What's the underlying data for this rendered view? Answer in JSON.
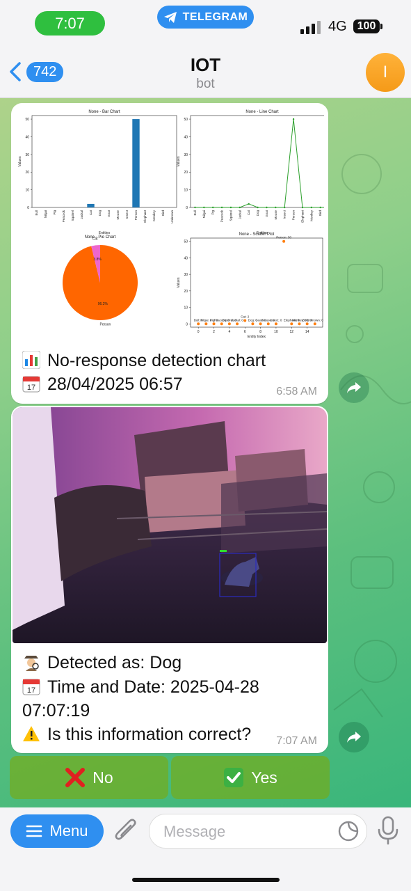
{
  "status_bar": {
    "time": "7:07",
    "app_pill": "TELEGRAM",
    "network": "4G",
    "battery": "100"
  },
  "header": {
    "back_count": "742",
    "title": "IOT",
    "subtitle": "bot",
    "avatar_letter": "I"
  },
  "chart_message": {
    "caption_line1": "No-response detection chart",
    "caption_line2": "28/04/2025 06:57",
    "time": "6:58 AM",
    "emoji1": "bar-chart-icon",
    "emoji2": "calendar-icon"
  },
  "chart_data": [
    {
      "type": "bar",
      "title": "None - Bar Chart",
      "xlabel": "Entities",
      "ylabel": "Values",
      "categories": [
        "Bull",
        "Nilgai",
        "Pig",
        "Peacock",
        "Squirrel",
        "Jackal",
        "Cat",
        "Dog",
        "Goat",
        "Mouse",
        "Insect",
        "Person",
        "Elephant",
        "Monkey",
        "Bird",
        "Unknown"
      ],
      "values": [
        0,
        0,
        0,
        0,
        0,
        0,
        2,
        0,
        0,
        0,
        0,
        50,
        0,
        0,
        0,
        0
      ],
      "yticks": [
        "0",
        "10",
        "20",
        "30",
        "40",
        "50"
      ],
      "ylim": [
        0,
        52
      ],
      "color": "#1f77b4"
    },
    {
      "type": "line",
      "title": "None - Line Chart",
      "xlabel": "Entities",
      "ylabel": "Values",
      "categories": [
        "Bull",
        "Nilgai",
        "Pig",
        "Peacock",
        "Squirrel",
        "Jackal",
        "Cat",
        "Dog",
        "Goat",
        "Mouse",
        "Insect",
        "Person",
        "Elephant",
        "Monkey",
        "Bird",
        "Unknown"
      ],
      "values": [
        0,
        0,
        0,
        0,
        0,
        0,
        2,
        0,
        0,
        0,
        0,
        50,
        0,
        0,
        0,
        0
      ],
      "yticks": [
        "0",
        "10",
        "20",
        "30",
        "40",
        "50"
      ],
      "ylim": [
        0,
        52
      ],
      "color": "#2ca02c"
    },
    {
      "type": "pie",
      "title": "None - Pie Chart",
      "slices": [
        {
          "label": "Person",
          "value": 96.2,
          "pct": "96.2%",
          "color": "#ff6600"
        },
        {
          "label": "Cat",
          "value": 3.8,
          "pct": "3.8%",
          "color": "#ee66cc"
        }
      ]
    },
    {
      "type": "scatter",
      "title": "None - Scatter Plot",
      "xlabel": "Entity Index",
      "ylabel": "Values",
      "x": [
        0,
        1,
        2,
        3,
        4,
        5,
        6,
        7,
        8,
        9,
        10,
        11,
        12,
        13,
        14,
        15
      ],
      "y": [
        0,
        0,
        0,
        0,
        0,
        0,
        2,
        0,
        0,
        0,
        0,
        50,
        0,
        0,
        0,
        0
      ],
      "point_labels": [
        "Bull: 0",
        "Nilgai: 0",
        "Pig: 0",
        "Peacock: 0",
        "Squirrel: 0",
        "Jackal: 0",
        "Cat: 2",
        "Dog: 0",
        "Goat: 0",
        "Mouse: 0",
        "Insect: 0",
        "Person: 50",
        "Elephant: 0",
        "Monkey: 0",
        "Bird: 0",
        "Unknown: 0"
      ],
      "xticks": [
        "0",
        "2",
        "4",
        "6",
        "8",
        "10",
        "12",
        "14"
      ],
      "yticks": [
        "0",
        "10",
        "20",
        "30",
        "40",
        "50"
      ],
      "xlim": [
        -1,
        16
      ],
      "ylim": [
        -2,
        52
      ],
      "color": "#ff7f0e"
    }
  ],
  "detection_message": {
    "line1": "Detected as: Dog",
    "line2": "Time and Date: 2025-04-28",
    "line3": "07:07:19",
    "line4": "Is this information correct?",
    "time": "7:07 AM",
    "emoji1": "detective-icon",
    "emoji2": "calendar-icon",
    "emoji3": "warning-icon"
  },
  "keyboard": {
    "no_label": "No",
    "yes_label": "Yes"
  },
  "input_bar": {
    "menu_label": "Menu",
    "placeholder": "Message"
  },
  "colors": {
    "accent": "#2f8ff0",
    "time_pill": "#2fbf3f",
    "avatar": "#f59a18"
  }
}
